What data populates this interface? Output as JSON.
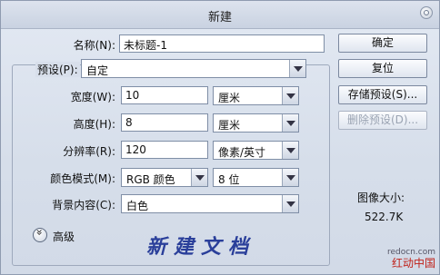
{
  "dialog": {
    "title": "新建"
  },
  "name_field": {
    "label": "名称(N):",
    "value": "未标题-1"
  },
  "preset": {
    "label": "预设(P):",
    "value": "自定"
  },
  "width": {
    "label": "宽度(W):",
    "value": "10",
    "unit": "厘米"
  },
  "height": {
    "label": "高度(H):",
    "value": "8",
    "unit": "厘米"
  },
  "resolution": {
    "label": "分辨率(R):",
    "value": "120",
    "unit": "像素/英寸"
  },
  "color_mode": {
    "label": "颜色模式(M):",
    "value": "RGB 颜色",
    "bits": "8 位"
  },
  "background": {
    "label": "背景内容(C):",
    "value": "白色"
  },
  "advanced": {
    "label": "高级"
  },
  "buttons": {
    "ok": "确定",
    "reset": "复位",
    "save_preset": "存储预设(S)...",
    "delete_preset": "删除预设(D)..."
  },
  "image_size": {
    "label": "图像大小:",
    "value": "522.7K"
  },
  "watermark_text": "新建文档",
  "brand": {
    "url": "redocn.com",
    "name": "红动中国"
  }
}
